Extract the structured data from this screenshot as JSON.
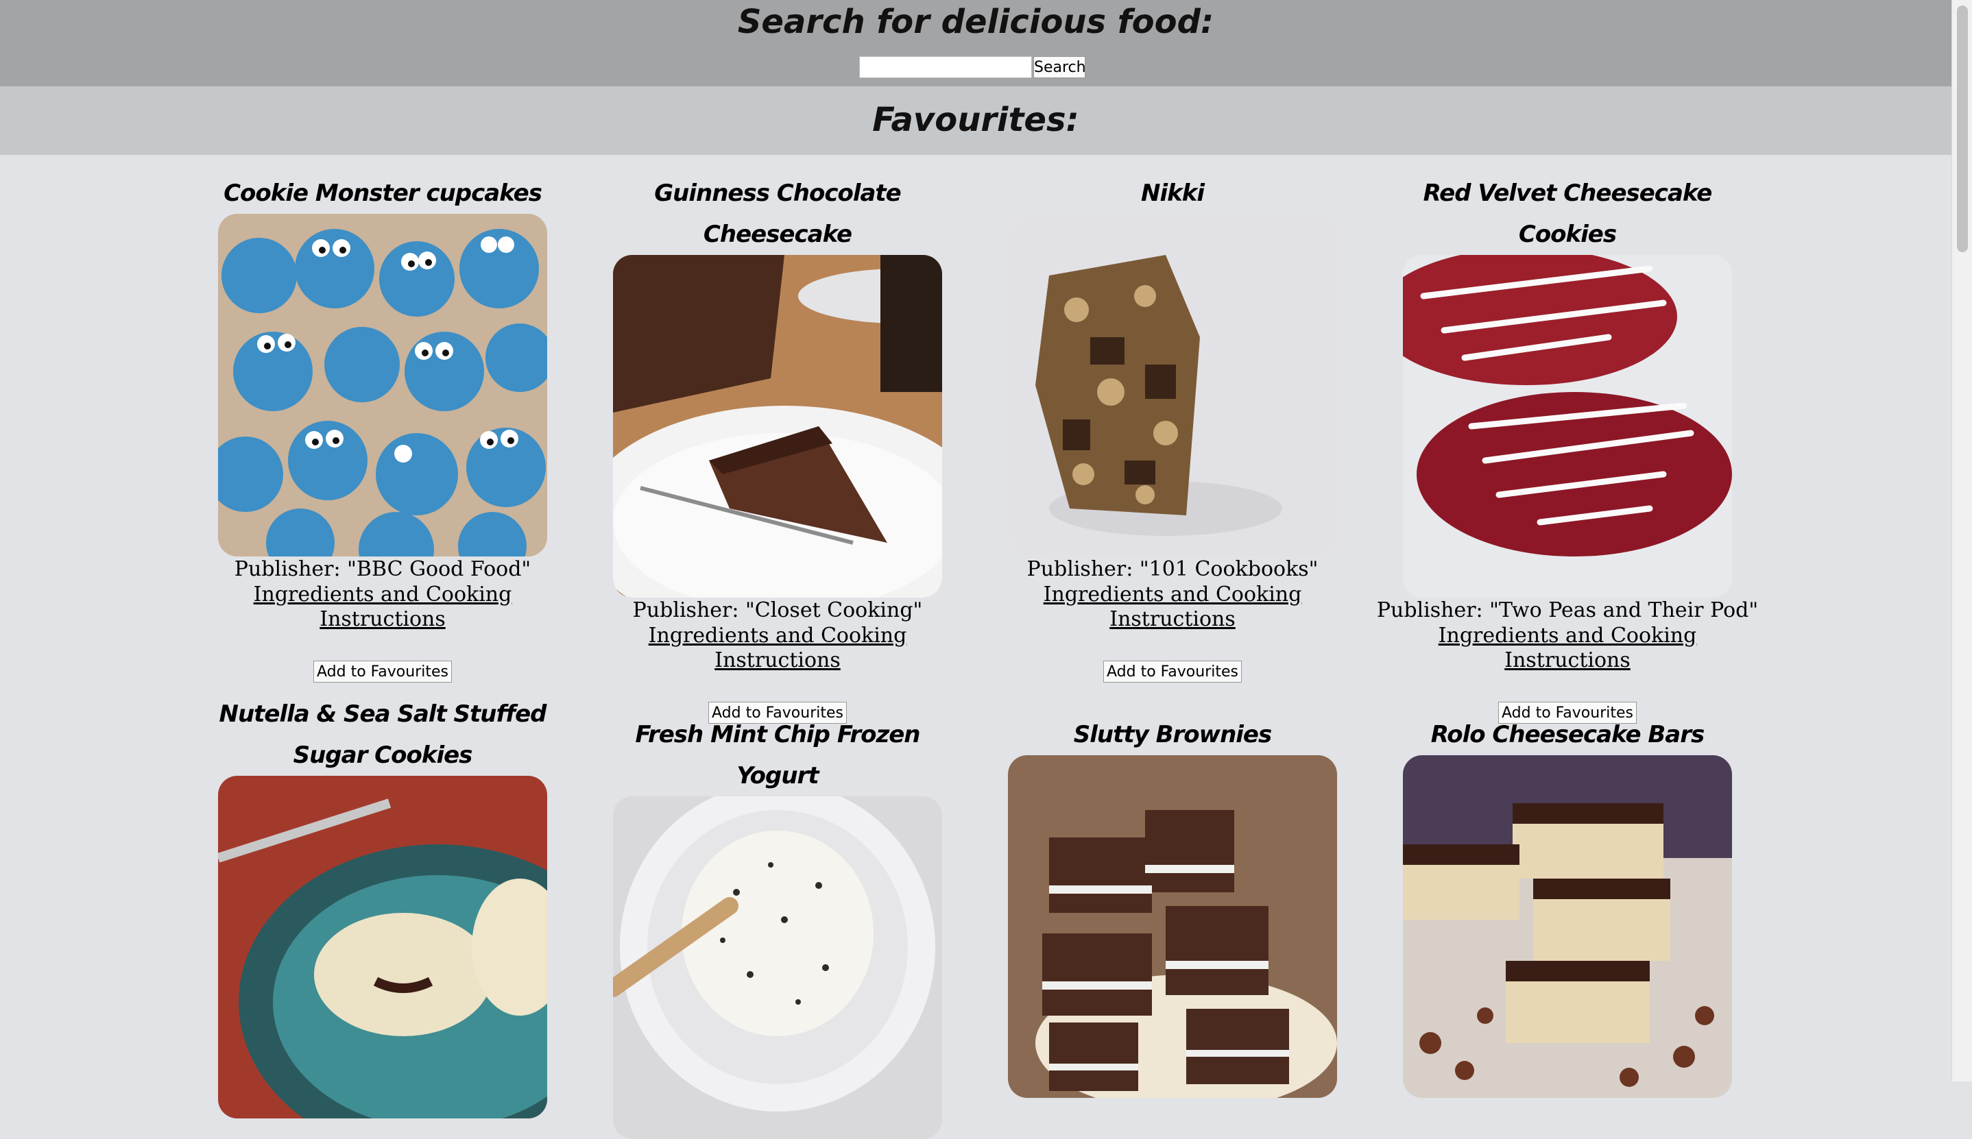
{
  "search": {
    "title": "Search for delicious food:",
    "placeholder": "",
    "value": "",
    "button_label": "Search"
  },
  "favourites": {
    "title": "Favourites:"
  },
  "recipes": [
    {
      "title": "Cookie Monster cupcakes",
      "publisher": "Publisher: \"BBC Good Food\"",
      "link": "Ingredients and Cooking Instructions",
      "button": "Add to Favourites"
    },
    {
      "title": "Guinness Chocolate Cheesecake",
      "publisher": "Publisher: \"Closet Cooking\"",
      "link": "Ingredients and Cooking Instructions",
      "button": "Add to Favourites"
    },
    {
      "title": "Nikki",
      "publisher": "Publisher: \"101 Cookbooks\"",
      "link": "Ingredients and Cooking Instructions",
      "button": "Add to Favourites"
    },
    {
      "title": "Red Velvet Cheesecake Cookies",
      "publisher": "Publisher: \"Two Peas and Their Pod\"",
      "link": "Ingredients and Cooking Instructions",
      "button": "Add to Favourites"
    },
    {
      "title": "Nutella & Sea Salt Stuffed Sugar Cookies"
    },
    {
      "title": "Fresh Mint Chip Frozen Yogurt"
    },
    {
      "title": "Slutty Brownies"
    },
    {
      "title": "Rolo Cheesecake Bars"
    }
  ],
  "colors": {
    "header_bg": "#a3a4a6",
    "favourites_bg": "#c5c8cb",
    "page_bg": "#e1e3e6"
  }
}
